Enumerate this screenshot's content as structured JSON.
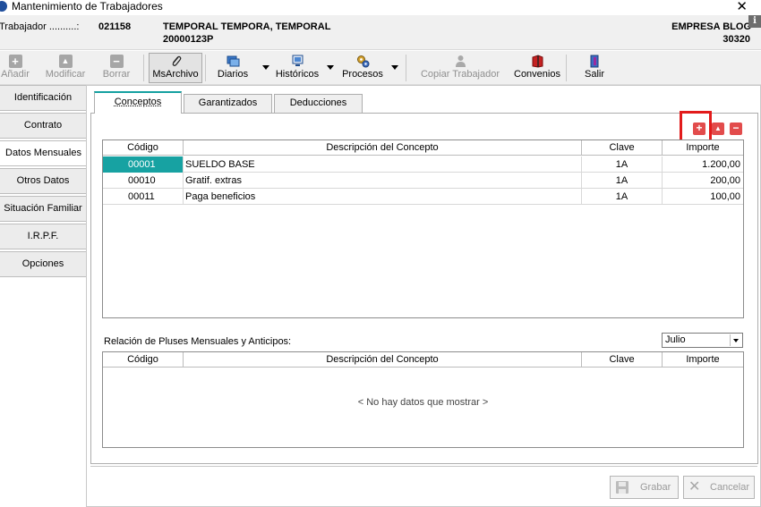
{
  "window": {
    "title": "Mantenimiento de Trabajadores",
    "close": "✕"
  },
  "worker": {
    "label": "Trabajador ..........:",
    "code": "021158",
    "name": "TEMPORAL TEMPORA, TEMPORAL",
    "nif": "20000123P",
    "company": "EMPRESA BLOG",
    "company_code": "30320",
    "info_badge": "i"
  },
  "toolbar": {
    "add": "Añadir",
    "modify": "Modificar",
    "delete": "Borrar",
    "msarchivo": "MsArchivo",
    "diarios": "Diarios",
    "historicos": "Históricos",
    "procesos": "Procesos",
    "copy_worker": "Copiar Trabajador",
    "convenios": "Convenios",
    "exit": "Salir"
  },
  "sidebar": {
    "items": [
      {
        "label": "Identificación"
      },
      {
        "label": "Contrato"
      },
      {
        "label": "Datos Mensuales"
      },
      {
        "label": "Otros Datos"
      },
      {
        "label": "Situación Familiar"
      },
      {
        "label": "I.R.P.F."
      },
      {
        "label": "Opciones"
      }
    ],
    "active_index": 2
  },
  "tabs": [
    {
      "label": "Conceptos"
    },
    {
      "label": "Garantizados"
    },
    {
      "label": "Deducciones"
    }
  ],
  "grid_buttons": {
    "add": "+",
    "up": "▲",
    "remove": "−"
  },
  "columns": [
    "Código",
    "Descripción del Concepto",
    "Clave",
    "Importe"
  ],
  "concepts": [
    {
      "code": "00001",
      "desc": "SUELDO BASE",
      "clave": "1A",
      "importe": "1.200,00"
    },
    {
      "code": "00010",
      "desc": "Gratif. extras",
      "clave": "1A",
      "importe": "200,00"
    },
    {
      "code": "00011",
      "desc": "Paga beneficios",
      "clave": "1A",
      "importe": "100,00"
    }
  ],
  "pluses": {
    "label": "Relación de Pluses Mensuales y Anticipos:",
    "month": "Julio",
    "empty": "< No hay datos que mostrar >"
  },
  "footer": {
    "save": "Grabar",
    "cancel": "Cancelar"
  },
  "colors": {
    "accent": "#17a2a2",
    "highlight": "#e21b1b",
    "red_button": "#e24c4c"
  }
}
